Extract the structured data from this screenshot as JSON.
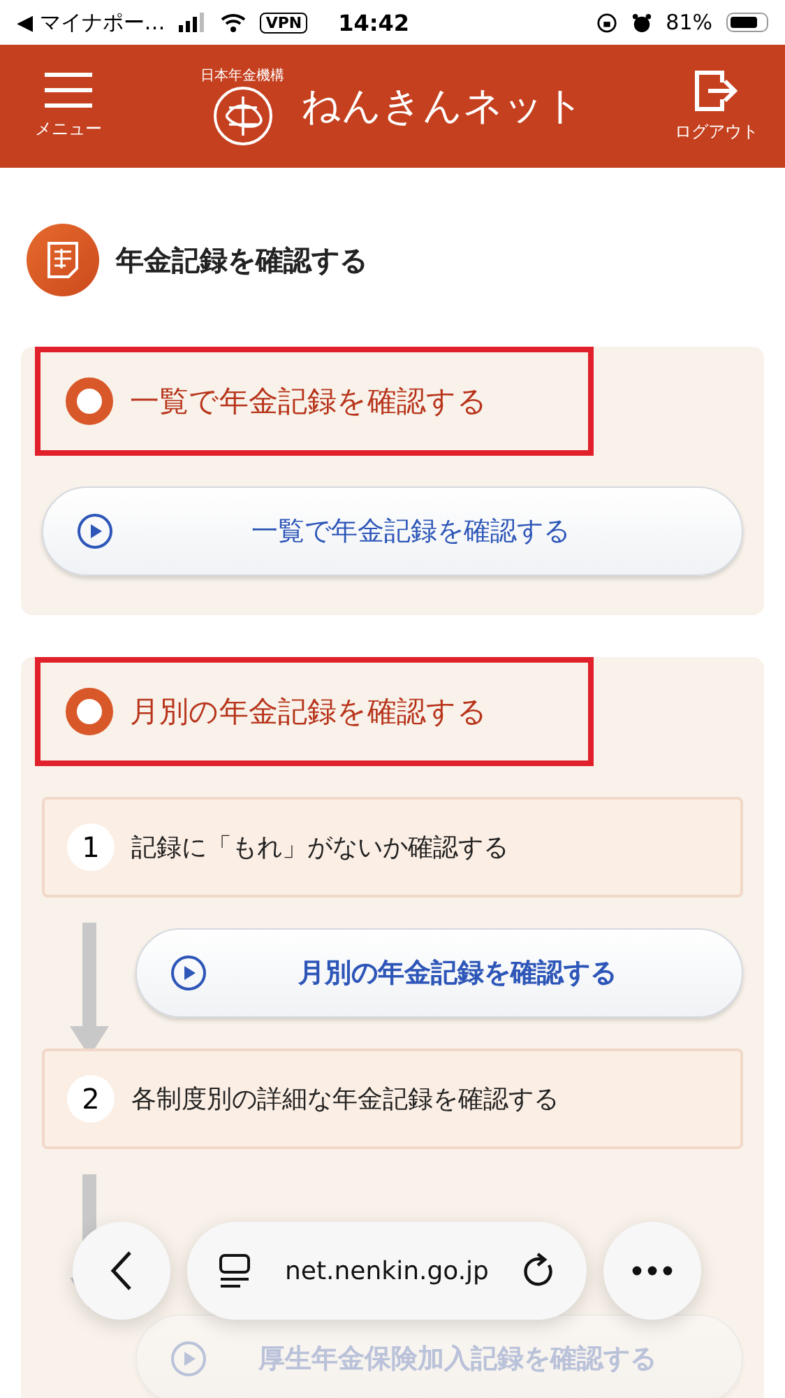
{
  "status_bar": {
    "back_app": "◀ マイナポー…",
    "vpn": "VPN",
    "time": "14:42",
    "battery": "81%"
  },
  "header": {
    "menu_label": "メニュー",
    "logo_caption": "日本年金機構",
    "title": "ねんきんネット",
    "logout_label": "ログアウト"
  },
  "page_title": "年金記録を確認する",
  "sections": [
    {
      "heading": "一覧で年金記録を確認する",
      "highlighted": true,
      "items": [
        {
          "kind": "button",
          "label": "一覧で年金記録を確認する",
          "bold": false
        }
      ]
    },
    {
      "heading": "月別の年金記録を確認する",
      "highlighted": true,
      "items": [
        {
          "kind": "step",
          "number": "1",
          "label": "記録に「もれ」がないか確認する"
        },
        {
          "kind": "button",
          "label": "月別の年金記録を確認する",
          "bold": true
        },
        {
          "kind": "step",
          "number": "2",
          "label": "各制度別の詳細な年金記録を確認する"
        },
        {
          "kind": "faded_button",
          "label": "厚生年金保険加入記録を確認する"
        }
      ]
    }
  ],
  "browser_bar": {
    "url": "net.nenkin.go.jp"
  }
}
